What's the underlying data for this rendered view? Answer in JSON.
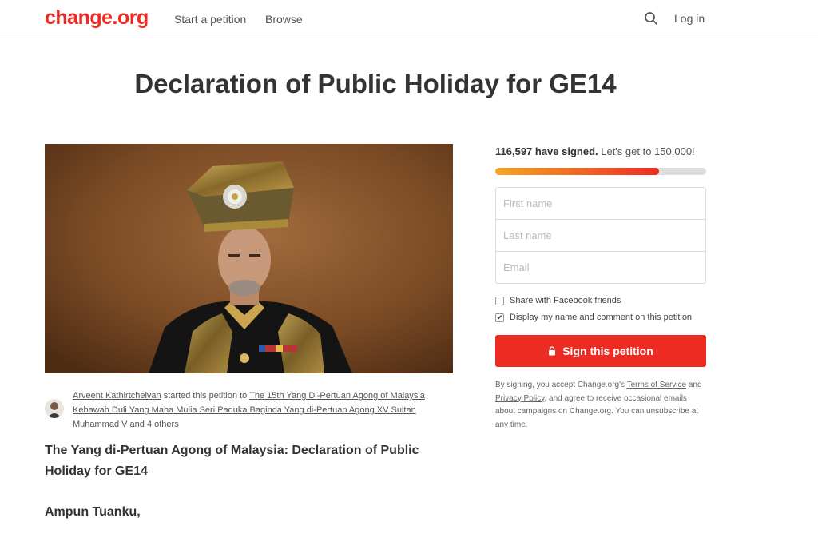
{
  "header": {
    "logo": "change.org",
    "nav": {
      "start": "Start a petition",
      "browse": "Browse"
    },
    "login": "Log in",
    "search_icon": "search-icon"
  },
  "petition": {
    "title": "Declaration of Public Holiday for GE14",
    "starter_name": "Arveent Kathirtchelvan",
    "started_text": " started this petition to ",
    "target_link": "The 15th Yang Di-Pertuan Agong of Malaysia Kebawah Duli Yang Maha Mulia Seri Paduka Baginda Yang di-Pertuan Agong XV Sultan Muhammad V",
    "and_text": " and ",
    "others_link": "4 others",
    "subtitle": "The Yang di-Pertuan Agong of Malaysia: Declaration of Public Holiday for GE14",
    "greeting": "Ampun Tuanku,"
  },
  "sidebar": {
    "signed_count": "116,597 have signed.",
    "goal_text": " Let's get to 150,000!",
    "progress_fraction": 0.7773,
    "fields": {
      "first_name_placeholder": "First name",
      "last_name_placeholder": "Last name",
      "email_placeholder": "Email"
    },
    "checkboxes": {
      "facebook_label": "Share with Facebook friends",
      "facebook_checked": false,
      "display_label": "Display my name and comment on this petition",
      "display_checked": true
    },
    "sign_button": "Sign this petition",
    "legal": {
      "before": "By signing, you accept Change.org's ",
      "terms_link": "Terms of Service",
      "and": " and ",
      "privacy_link": "Privacy Policy",
      "after": ", and agree to receive occasional emails about campaigns on Change.org. You can unsubscribe at any time."
    }
  },
  "colors": {
    "brand_red": "#ec2c22",
    "progress_start": "#f5a623"
  }
}
